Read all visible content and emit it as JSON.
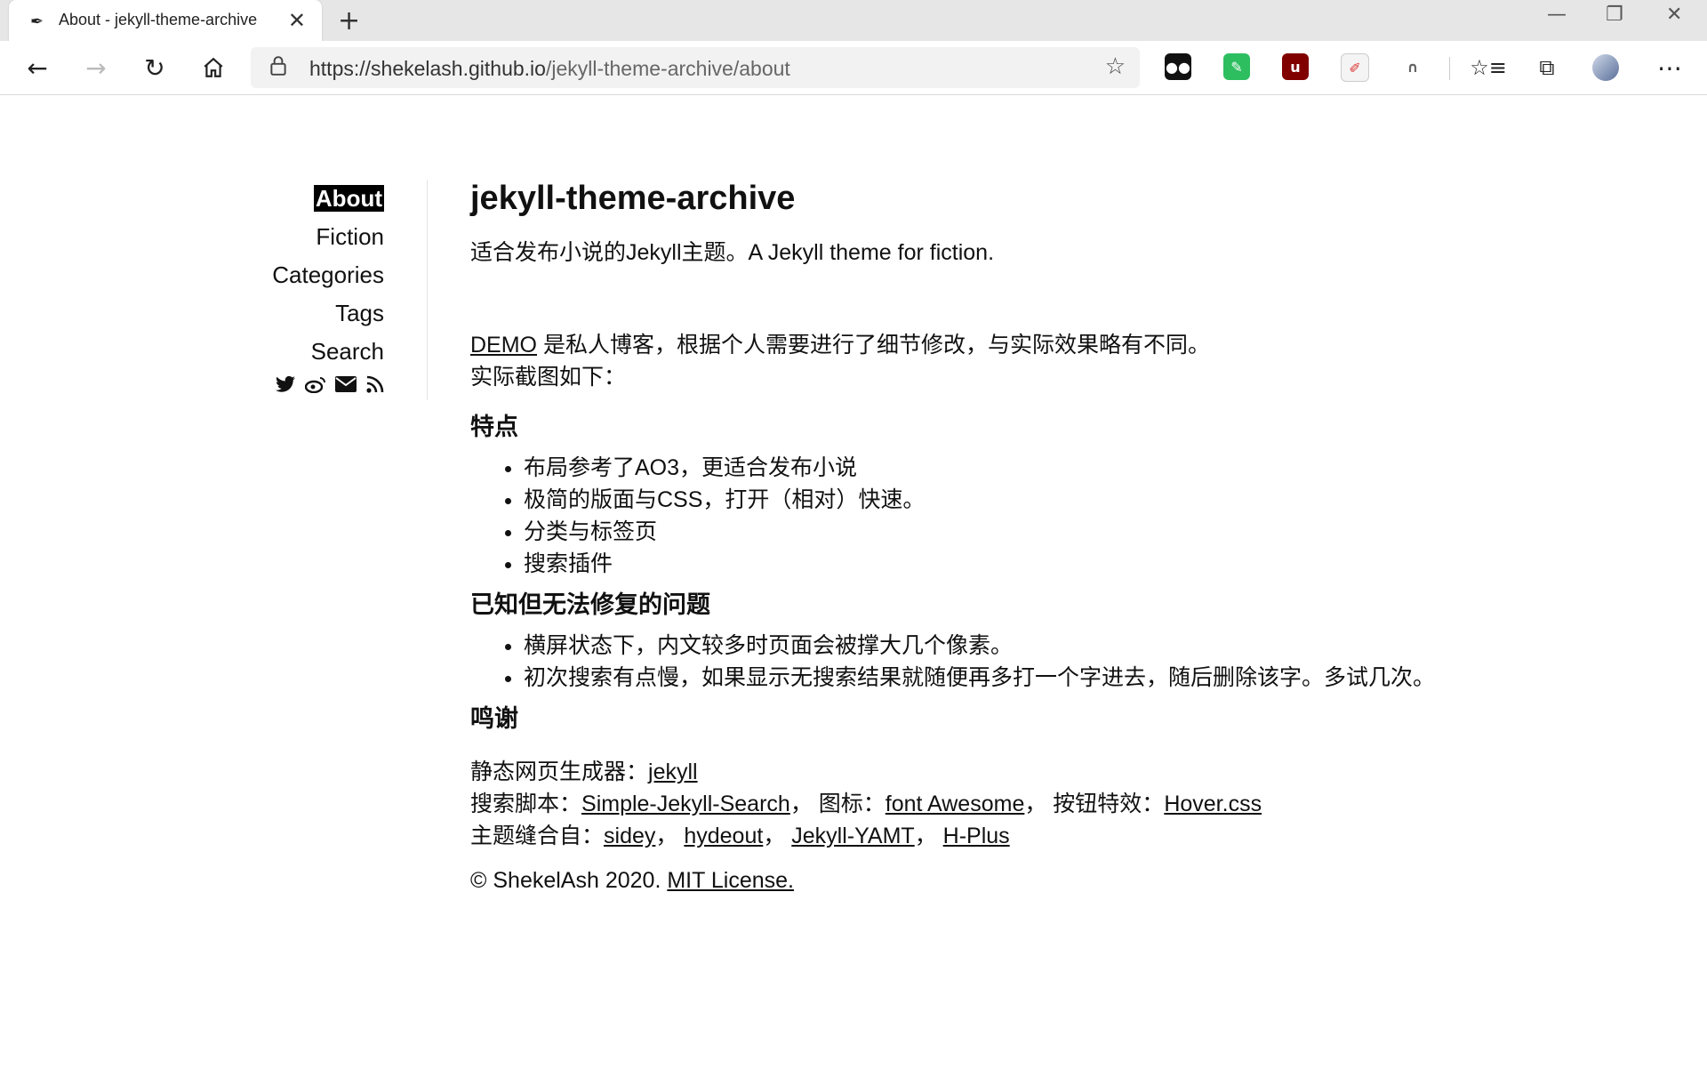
{
  "browser": {
    "tab_title": "About - jekyll-theme-archive",
    "url_host": "https://shekelash.github.io",
    "url_path": "/jekyll-theme-archive/about"
  },
  "sidebar": {
    "items": [
      {
        "label": "About"
      },
      {
        "label": "Fiction"
      },
      {
        "label": "Categories"
      },
      {
        "label": "Tags"
      },
      {
        "label": "Search"
      }
    ],
    "social_icons": [
      "twitter-icon",
      "weibo-icon",
      "mail-icon",
      "rss-icon"
    ]
  },
  "main": {
    "title": "jekyll-theme-archive",
    "subtitle": "适合发布小说的Jekyll主题。A Jekyll theme for fiction.",
    "demo_link": "DEMO",
    "demo_text": " 是私人博客，根据个人需要进行了细节修改，与实际效果略有不同。",
    "screenshot_text": "实际截图如下：",
    "features_heading": "特点",
    "features": [
      "布局参考了AO3，更适合发布小说",
      "极简的版面与CSS，打开（相对）快速。",
      "分类与标签页",
      "搜索插件"
    ],
    "issues_heading": "已知但无法修复的问题",
    "issues": [
      "横屏状态下，内文较多时页面会被撑大几个像素。",
      "初次搜索有点慢，如果显示无搜索结果就随便再多打一个字进去，随后删除该字。多试几次。"
    ],
    "thanks_heading": "鸣谢",
    "generator_label": "静态网页生成器：",
    "generator_link": "jekyll",
    "search_label": "搜索脚本：",
    "search_link": "Simple-Jekyll-Search",
    "icon_label": "， 图标：",
    "icon_link": "font Awesome",
    "button_label": "， 按钮特效：",
    "button_link": "Hover.css",
    "theme_label": "主题缝合自：",
    "theme_links": [
      "sidey",
      "hydeout",
      "Jekyll-YAMT",
      "H-Plus"
    ],
    "theme_sep": "， ",
    "copyright": "© ShekelAsh 2020. ",
    "license_link": "MIT License."
  }
}
